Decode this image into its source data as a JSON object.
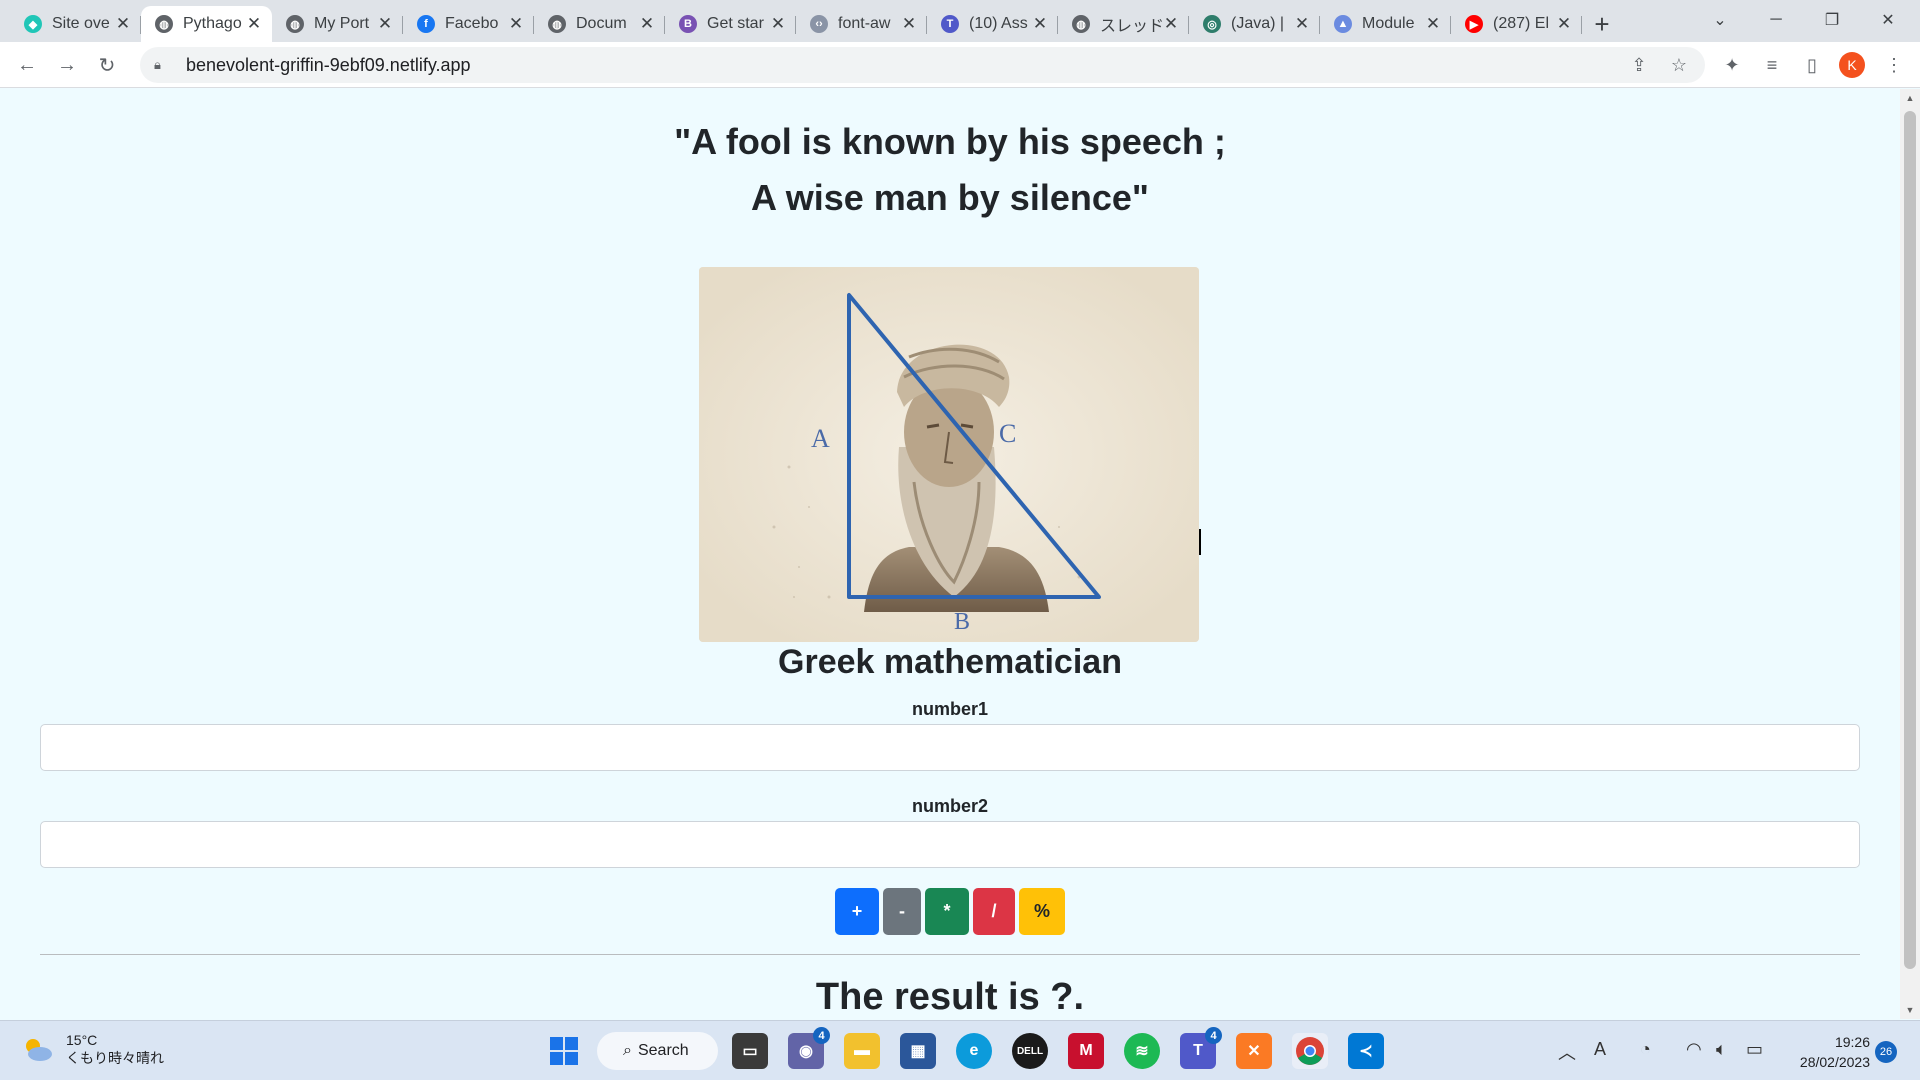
{
  "browser": {
    "tabs": [
      {
        "title": "Site ove",
        "icon": "netlify-icon",
        "color": "#20c6b7",
        "glyph": "◆",
        "active": false
      },
      {
        "title": "Pythago",
        "icon": "globe-icon",
        "color": "#5f6368",
        "glyph": "◍",
        "active": true
      },
      {
        "title": "My Port",
        "icon": "globe-icon",
        "color": "#5f6368",
        "glyph": "◍",
        "active": false
      },
      {
        "title": "Facebo",
        "icon": "facebook-icon",
        "color": "#1877f2",
        "glyph": "f",
        "active": false
      },
      {
        "title": "Docum",
        "icon": "globe-icon",
        "color": "#5f6368",
        "glyph": "◍",
        "active": false
      },
      {
        "title": "Get star",
        "icon": "bootstrap-icon",
        "color": "#7952b3",
        "glyph": "B",
        "active": false
      },
      {
        "title": "font-aw",
        "icon": "code-icon",
        "color": "#8a94a6",
        "glyph": "‹›",
        "active": false
      },
      {
        "title": "(10) Ass",
        "icon": "teams-icon",
        "color": "#5059c9",
        "glyph": "T",
        "active": false
      },
      {
        "title": "スレッド",
        "icon": "globe-icon",
        "color": "#5f6368",
        "glyph": "◍",
        "active": false
      },
      {
        "title": "(Java) |",
        "icon": "site-icon",
        "color": "#2e7d6b",
        "glyph": "◎",
        "active": false
      },
      {
        "title": "Module",
        "icon": "graduation-cap-icon",
        "color": "#6b8be0",
        "glyph": "▲",
        "active": false
      },
      {
        "title": "(287) El",
        "icon": "youtube-icon",
        "color": "#ff0000",
        "glyph": "▶",
        "active": false
      }
    ],
    "url": "benevolent-griffin-9ebf09.netlify.app",
    "profile_initial": "K"
  },
  "page": {
    "quote_line1": "\"A fool is known by his speech ;",
    "quote_line2": "A wise man by silence\"",
    "portrait_labels": {
      "a": "A",
      "b": "B",
      "c": "C"
    },
    "caption": "Greek mathematician",
    "number1_label": "number1",
    "number2_label": "number2",
    "number1_value": "",
    "number2_value": "",
    "operators": [
      {
        "label": "+",
        "color": "#0d6efd",
        "name": "add-button"
      },
      {
        "label": "-",
        "color": "#6c757d",
        "name": "subtract-button"
      },
      {
        "label": "*",
        "color": "#198754",
        "name": "multiply-button"
      },
      {
        "label": "/",
        "color": "#dc3545",
        "name": "divide-button"
      },
      {
        "label": "%",
        "color": "#ffc107",
        "name": "modulo-button"
      }
    ],
    "result_text": "The result is ?."
  },
  "taskbar": {
    "weather_temp": "15°C",
    "weather_desc": "くもり時々晴れ",
    "search_label": "Search",
    "chat_badge": "4",
    "teams_badge": "4",
    "time": "19:26",
    "date": "28/02/2023",
    "notifications": "26"
  }
}
